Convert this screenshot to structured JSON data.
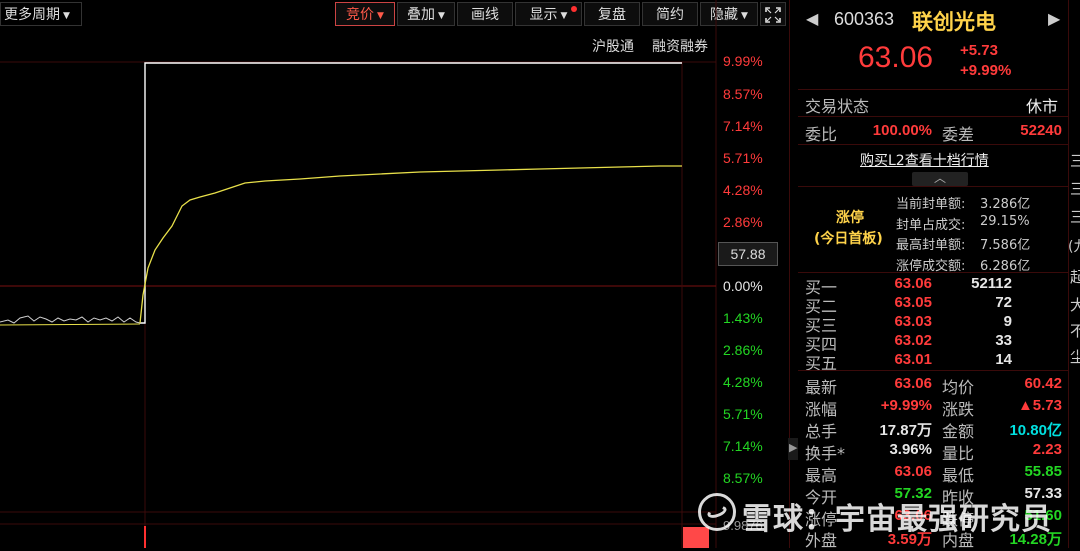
{
  "toolbar": {
    "period": "更多周期",
    "buttons": [
      "竞价",
      "叠加",
      "画线",
      "显示",
      "复盘",
      "简约",
      "隐藏"
    ],
    "links": [
      "沪股通",
      "融资融券"
    ]
  },
  "chart": {
    "upper_pct": [
      "9.99%",
      "8.57%",
      "7.14%",
      "5.71%",
      "4.28%",
      "2.86%"
    ],
    "price_box": "57.88",
    "zero": "0.00%",
    "lower_pct": [
      "1.43%",
      "2.86%",
      "4.28%",
      "5.71%",
      "7.14%",
      "8.57%"
    ],
    "bottom_label": "9.9876"
  },
  "stock": {
    "code": "600363",
    "name": "联创光电",
    "price": "63.06",
    "change": "+5.73",
    "change_pct": "+9.99%"
  },
  "status": {
    "label": "交易状态",
    "value": "休市"
  },
  "weibi": {
    "label1": "委比",
    "value1": "100.00%",
    "label2": "委差",
    "value2": "52240"
  },
  "l2_link": "购买L2查看十档行情",
  "limit": {
    "tag1": "涨停",
    "tag2": "(今日首板)",
    "rows": [
      {
        "label": "当前封单额:",
        "value": "3.286亿"
      },
      {
        "label": "封单占成交:",
        "value": "29.15%"
      },
      {
        "label": "最高封单额:",
        "value": "7.586亿"
      },
      {
        "label": "涨停成交额:",
        "value": "6.286亿"
      }
    ]
  },
  "bids": [
    {
      "label": "买一",
      "price": "63.06",
      "vol": "52112"
    },
    {
      "label": "买二",
      "price": "63.05",
      "vol": "72"
    },
    {
      "label": "买三",
      "price": "63.03",
      "vol": "9"
    },
    {
      "label": "买四",
      "price": "63.02",
      "vol": "33"
    },
    {
      "label": "买五",
      "price": "63.01",
      "vol": "14"
    }
  ],
  "quote": [
    {
      "l1": "最新",
      "v1": "63.06",
      "c1": "red",
      "l2": "均价",
      "v2": "60.42",
      "c2": "red"
    },
    {
      "l1": "涨幅",
      "v1": "+9.99%",
      "c1": "red",
      "l2": "涨跌",
      "v2": "▲5.73",
      "c2": "red"
    },
    {
      "l1": "总手",
      "v1": "17.87万",
      "c1": "white",
      "l2": "金额",
      "v2": "10.80亿",
      "c2": "cyan"
    },
    {
      "l1": "换手*",
      "v1": "3.96%",
      "c1": "white",
      "l2": "量比",
      "v2": "2.23",
      "c2": "red"
    },
    {
      "l1": "最高",
      "v1": "63.06",
      "c1": "red",
      "l2": "最低",
      "v2": "55.85",
      "c2": "green"
    },
    {
      "l1": "今开",
      "v1": "57.32",
      "c1": "green",
      "l2": "昨收",
      "v2": "57.33",
      "c2": "white"
    },
    {
      "l1": "涨停",
      "v1": "63.06",
      "c1": "red",
      "l2": "跌停",
      "v2": "51.60",
      "c2": "green"
    },
    {
      "l1": "外盘",
      "v1": "3.59万",
      "c1": "red",
      "l2": "内盘",
      "v2": "14.28万",
      "c2": "green"
    }
  ],
  "side_glyphs": [
    "三",
    "三",
    "三",
    "(九",
    "起",
    "大",
    "不",
    "尘"
  ],
  "watermark": "雪球：宇宙最强研究员"
}
